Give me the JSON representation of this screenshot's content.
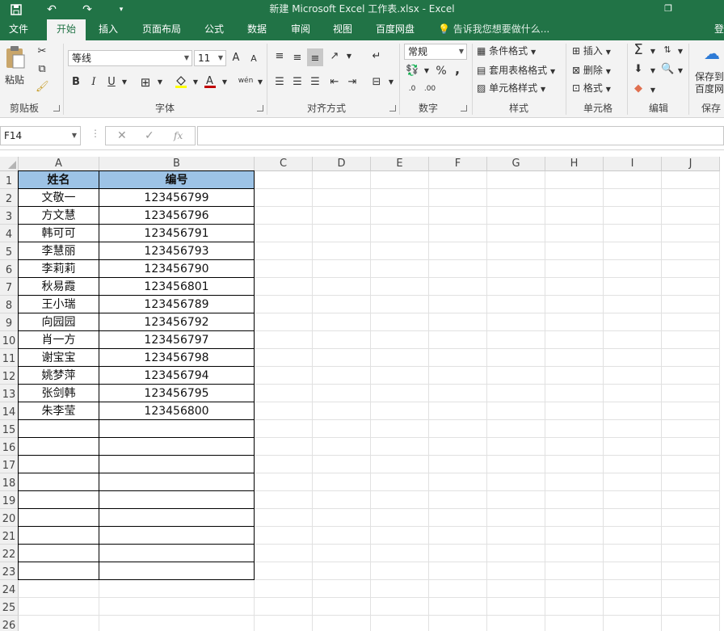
{
  "window": {
    "title": "新建 Microsoft Excel 工作表.xlsx - Excel",
    "restore_icon": "restore-icon"
  },
  "quick_access": {
    "save_icon": "save-icon",
    "undo_icon": "undo-icon",
    "redo_icon": "redo-icon",
    "customize_icon": "customize-icon"
  },
  "tabs": [
    {
      "label": "文件",
      "active": false
    },
    {
      "label": "开始",
      "active": true
    },
    {
      "label": "插入",
      "active": false
    },
    {
      "label": "页面布局",
      "active": false
    },
    {
      "label": "公式",
      "active": false
    },
    {
      "label": "数据",
      "active": false
    },
    {
      "label": "审阅",
      "active": false
    },
    {
      "label": "视图",
      "active": false
    },
    {
      "label": "百度网盘",
      "active": false
    }
  ],
  "tell_me": "告诉我您想要做什么...",
  "sign_in": "登",
  "ribbon": {
    "clipboard": {
      "paste_label": "粘贴",
      "group_label": "剪贴板"
    },
    "font": {
      "font_name": "等线",
      "font_size": "11",
      "bold": "B",
      "italic": "I",
      "underline": "U",
      "font_color_glyph": "A",
      "grow_glyph": "A",
      "shrink_glyph": "A",
      "phonetic_glyph": "wén",
      "group_label": "字体",
      "font_color": "#c00000",
      "fill_color": "#ffff00"
    },
    "alignment": {
      "group_label": "对齐方式"
    },
    "number": {
      "format": "常规",
      "percent": "%",
      "comma": ",",
      "group_label": "数字"
    },
    "styles": {
      "conditional": "条件格式",
      "table_format": "套用表格格式",
      "cell_styles": "单元格样式",
      "group_label": "样式"
    },
    "cells": {
      "insert": "插入",
      "delete": "删除",
      "format": "格式",
      "group_label": "单元格"
    },
    "editing": {
      "sum_glyph": "Σ",
      "group_label": "编辑"
    },
    "baidu": {
      "label_line1": "保存到",
      "label_line2": "百度网",
      "group_label": "保存"
    }
  },
  "formula_bar": {
    "name_box": "F14",
    "cancel": "✕",
    "enter": "✓",
    "fx": "fx",
    "content": ""
  },
  "sheet": {
    "columns": [
      "A",
      "B",
      "C",
      "D",
      "E",
      "F",
      "G",
      "H",
      "I",
      "J"
    ],
    "row_numbers": [
      "1",
      "2",
      "3",
      "4",
      "5",
      "6",
      "7",
      "8",
      "9",
      "10",
      "11",
      "12",
      "13",
      "14",
      "15",
      "16",
      "17",
      "18",
      "19",
      "20",
      "21",
      "22",
      "23",
      "24",
      "25",
      "26"
    ],
    "header_fill": "#9dc3e6",
    "header": [
      "姓名",
      "编号"
    ],
    "rows": [
      [
        "文敬一",
        "123456799"
      ],
      [
        "方文慧",
        "123456796"
      ],
      [
        "韩可可",
        "123456791"
      ],
      [
        "李慧丽",
        "123456793"
      ],
      [
        "李莉莉",
        "123456790"
      ],
      [
        "秋易霞",
        "123456801"
      ],
      [
        "王小瑞",
        "123456789"
      ],
      [
        "向园园",
        "123456792"
      ],
      [
        "肖一方",
        "123456797"
      ],
      [
        "谢宝宝",
        "123456798"
      ],
      [
        "姚梦萍",
        "123456794"
      ],
      [
        "张剑韩",
        "123456795"
      ],
      [
        "朱李莹",
        "123456800"
      ]
    ]
  }
}
